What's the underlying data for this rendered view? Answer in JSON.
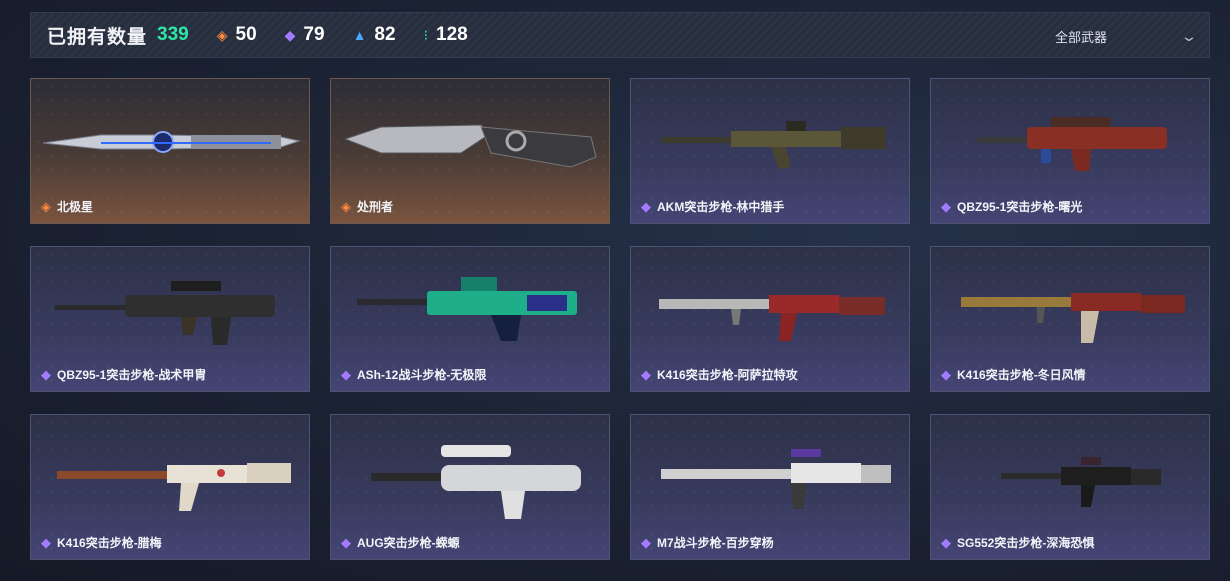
{
  "header": {
    "owned_label": "已拥有数量",
    "owned_count": "339",
    "stats": [
      {
        "icon": "orange-diamond-icon",
        "color": "#ff8a3d",
        "value": "50"
      },
      {
        "icon": "purple-diamond-icon",
        "color": "#a27bff",
        "value": "79"
      },
      {
        "icon": "blue-diamond-icon",
        "color": "#4da6ff",
        "value": "82"
      },
      {
        "icon": "teal-diamond-icon",
        "color": "#36e0b8",
        "value": "128"
      }
    ],
    "filter_label": "全部武器"
  },
  "items": [
    {
      "name": "北极星",
      "rarity": "legendary",
      "rarity_color": "#ff8a3d"
    },
    {
      "name": "处刑者",
      "rarity": "legendary",
      "rarity_color": "#ff8a3d"
    },
    {
      "name": "AKM突击步枪-林中猎手",
      "rarity": "epic",
      "rarity_color": "#a27bff"
    },
    {
      "name": "QBZ95-1突击步枪-曙光",
      "rarity": "epic",
      "rarity_color": "#a27bff"
    },
    {
      "name": "QBZ95-1突击步枪-战术甲胄",
      "rarity": "epic",
      "rarity_color": "#a27bff"
    },
    {
      "name": "ASh-12战斗步枪-无极限",
      "rarity": "epic",
      "rarity_color": "#a27bff"
    },
    {
      "name": "K416突击步枪-阿萨拉特攻",
      "rarity": "epic",
      "rarity_color": "#a27bff"
    },
    {
      "name": "K416突击步枪-冬日风情",
      "rarity": "epic",
      "rarity_color": "#a27bff"
    },
    {
      "name": "K416突击步枪-腊梅",
      "rarity": "epic",
      "rarity_color": "#a27bff"
    },
    {
      "name": "AUG突击步枪-蝾螈",
      "rarity": "epic",
      "rarity_color": "#a27bff"
    },
    {
      "name": "M7战斗步枪-百步穿杨",
      "rarity": "epic",
      "rarity_color": "#a27bff"
    },
    {
      "name": "SG552突击步枪-深海恐惧",
      "rarity": "epic",
      "rarity_color": "#a27bff"
    }
  ]
}
